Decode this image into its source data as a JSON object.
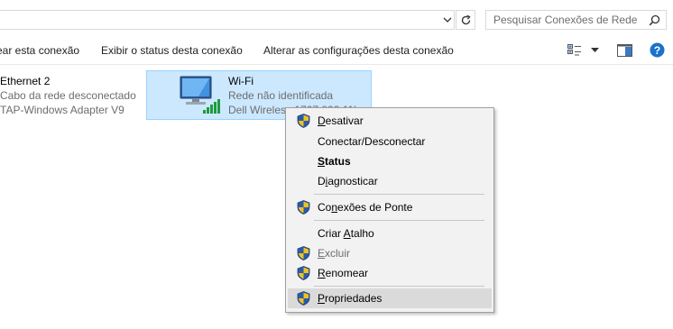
{
  "search": {
    "placeholder": "Pesquisar Conexões de Rede"
  },
  "toolbar": {
    "commands": [
      "ear esta conexão",
      "Exibir o status desta conexão",
      "Alterar as configurações desta conexão"
    ],
    "icons": [
      "change-view-icon",
      "chevron-down-icon",
      "preview-pane-icon",
      "help-icon"
    ]
  },
  "connections": [
    {
      "name": "Ethernet 2",
      "status": "Cabo da rede desconectado",
      "adapter": "TAP-Windows Adapter V9",
      "selected": false
    },
    {
      "name": "Wi-Fi",
      "status": "Rede não identificada",
      "adapter": "Dell Wireless 1707 802.11b",
      "selected": true
    }
  ],
  "context_menu": {
    "items": [
      {
        "pre": "",
        "key": "D",
        "post": "esativar",
        "shield": true,
        "bold": false,
        "disabled": false,
        "hover": false
      },
      {
        "pre": "Conectar/Desconectar",
        "key": "",
        "post": "",
        "shield": false,
        "bold": false,
        "disabled": false,
        "hover": false
      },
      {
        "pre": "",
        "key": "S",
        "post": "tatus",
        "shield": false,
        "bold": true,
        "disabled": false,
        "hover": false
      },
      {
        "pre": "D",
        "key": "i",
        "post": "agnosticar",
        "shield": false,
        "bold": false,
        "disabled": false,
        "hover": false
      },
      {
        "pre": "Co",
        "key": "n",
        "post": "exões de Ponte",
        "shield": true,
        "bold": false,
        "disabled": false,
        "hover": false
      },
      {
        "pre": "Criar ",
        "key": "A",
        "post": "talho",
        "shield": false,
        "bold": false,
        "disabled": false,
        "hover": false
      },
      {
        "pre": "",
        "key": "E",
        "post": "xcluir",
        "shield": true,
        "bold": false,
        "disabled": true,
        "hover": false
      },
      {
        "pre": "",
        "key": "R",
        "post": "enomear",
        "shield": true,
        "bold": false,
        "disabled": false,
        "hover": false
      },
      {
        "pre": "",
        "key": "P",
        "post": "ropriedades",
        "shield": true,
        "bold": false,
        "disabled": false,
        "hover": true
      }
    ]
  },
  "colors": {
    "selection_fill": "#cce8ff",
    "selection_border": "#99d1ff",
    "menu_bg": "#f2f2f2",
    "help_blue": "#1a72c9",
    "signal_green": "#1d9b3a"
  }
}
